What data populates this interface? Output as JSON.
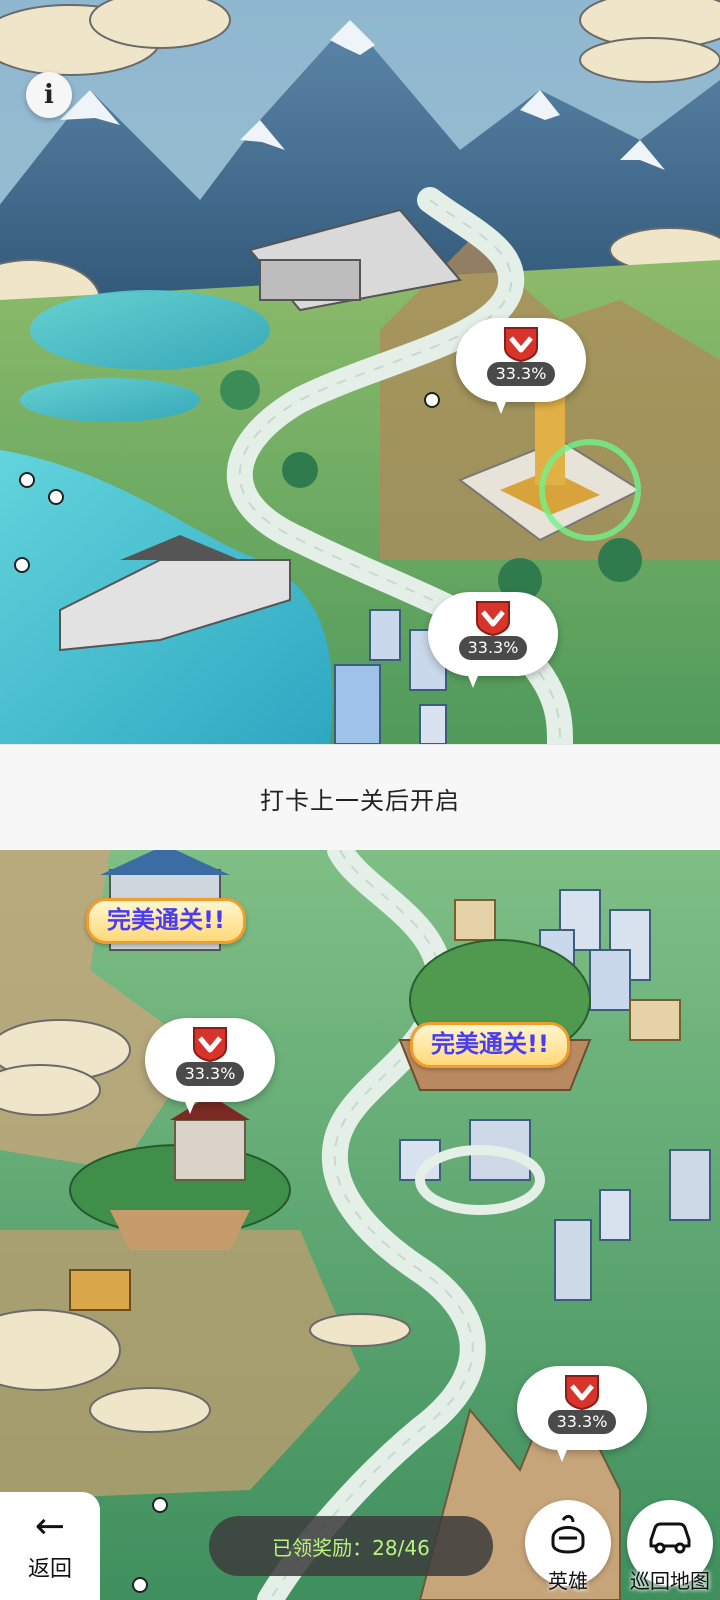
{
  "info_icon_glyph": "i",
  "lock_banner": "打卡上一关后开启",
  "pins": [
    {
      "pct": "33.3%"
    },
    {
      "pct": "33.3%"
    },
    {
      "pct": "33.3%"
    },
    {
      "pct": "33.3%"
    }
  ],
  "perfect_badges": [
    {
      "text": "完美通关!!"
    },
    {
      "text": "完美通关!!"
    }
  ],
  "bottom_bar": {
    "back_arrow": "←",
    "back_label": "返回",
    "rewards_text": "已领奖励：28/46",
    "hero_label": "英雄",
    "map_label": "巡回地图"
  },
  "colors": {
    "shield_red": "#d8342b",
    "reward_text": "#b6f57e",
    "badge_text": "#4a3cf0",
    "badge_border": "#f39b2b"
  },
  "icons": [
    "info-icon",
    "shield-check-icon",
    "back-arrow-icon",
    "hero-helmet-icon",
    "car-icon"
  ]
}
